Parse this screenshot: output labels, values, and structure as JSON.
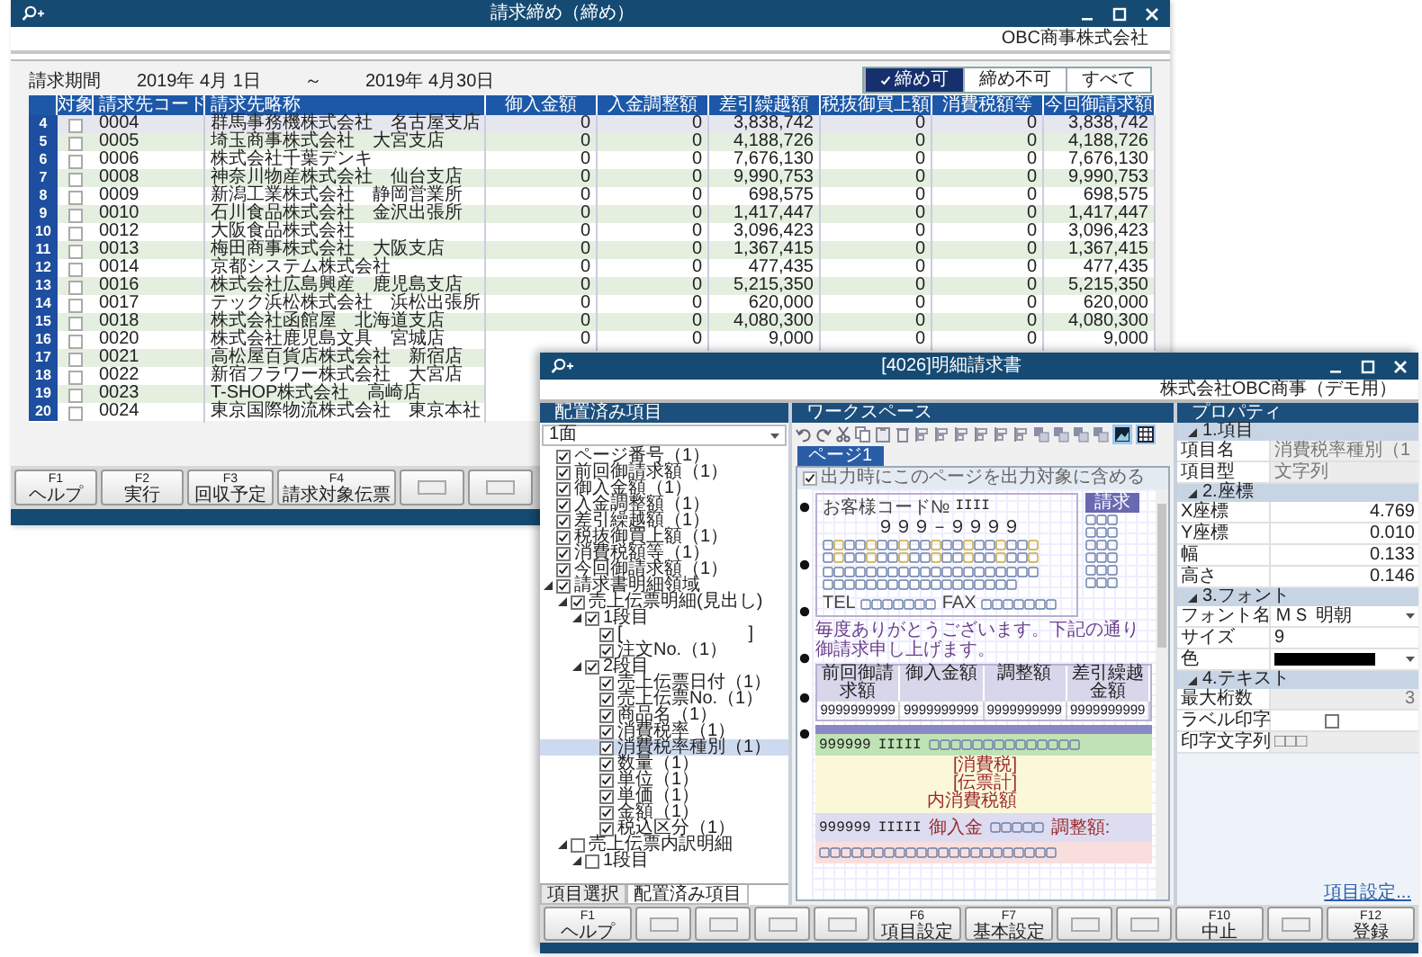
{
  "main_window": {
    "title": "請求締め（締め）",
    "company": "OBC商事株式会社",
    "period_label": "請求期間",
    "period_from": "2019年 4月 1日",
    "period_sep": "～",
    "period_to": "2019年 4月30日",
    "filters": [
      {
        "label": "締め可",
        "selected": true
      },
      {
        "label": "締め不可",
        "selected": false
      },
      {
        "label": "すべて",
        "selected": false
      }
    ],
    "table": {
      "check_column": "対象",
      "columns": [
        "請求先コード",
        "請求先略称",
        "御入金額",
        "入金調整額",
        "差引繰越額",
        "税抜御買上額",
        "消費税額等",
        "今回御請求額"
      ],
      "rows": [
        {
          "no": "4",
          "checked": false,
          "selected": true,
          "cells": [
            "0004",
            "群馬事務機株式会社　名古屋支店",
            "0",
            "0",
            "3,838,742",
            "0",
            "0",
            "3,838,742"
          ]
        },
        {
          "no": "5",
          "checked": false,
          "selected": false,
          "cells": [
            "0005",
            "埼玉商事株式会社　大宮支店",
            "0",
            "0",
            "4,188,726",
            "0",
            "0",
            "4,188,726"
          ]
        },
        {
          "no": "6",
          "checked": false,
          "selected": false,
          "cells": [
            "0006",
            "株式会社千葉デンキ",
            "0",
            "0",
            "7,676,130",
            "0",
            "0",
            "7,676,130"
          ]
        },
        {
          "no": "7",
          "checked": false,
          "selected": false,
          "cells": [
            "0008",
            "神奈川物産株式会社　仙台支店",
            "0",
            "0",
            "9,990,753",
            "0",
            "0",
            "9,990,753"
          ]
        },
        {
          "no": "8",
          "checked": false,
          "selected": false,
          "cells": [
            "0009",
            "新潟工業株式会社　静岡営業所",
            "0",
            "0",
            "698,575",
            "0",
            "0",
            "698,575"
          ]
        },
        {
          "no": "9",
          "checked": false,
          "selected": false,
          "cells": [
            "0010",
            "石川食品株式会社　金沢出張所",
            "0",
            "0",
            "1,417,447",
            "0",
            "0",
            "1,417,447"
          ]
        },
        {
          "no": "10",
          "checked": false,
          "selected": false,
          "cells": [
            "0012",
            "大阪食品株式会社",
            "0",
            "0",
            "3,096,423",
            "0",
            "0",
            "3,096,423"
          ]
        },
        {
          "no": "11",
          "checked": false,
          "selected": false,
          "cells": [
            "0013",
            "梅田商事株式会社　大阪支店",
            "0",
            "0",
            "1,367,415",
            "0",
            "0",
            "1,367,415"
          ]
        },
        {
          "no": "12",
          "checked": false,
          "selected": false,
          "cells": [
            "0014",
            "京都システム株式会社",
            "0",
            "0",
            "477,435",
            "0",
            "0",
            "477,435"
          ]
        },
        {
          "no": "13",
          "checked": false,
          "selected": false,
          "cells": [
            "0016",
            "株式会社広島興産　鹿児島支店",
            "0",
            "0",
            "5,215,350",
            "0",
            "0",
            "5,215,350"
          ]
        },
        {
          "no": "14",
          "checked": false,
          "selected": false,
          "cells": [
            "0017",
            "テック浜松株式会社　浜松出張所",
            "0",
            "0",
            "620,000",
            "0",
            "0",
            "620,000"
          ]
        },
        {
          "no": "15",
          "checked": false,
          "selected": false,
          "cells": [
            "0018",
            "株式会社函館屋　北海道支店",
            "0",
            "0",
            "4,080,300",
            "0",
            "0",
            "4,080,300"
          ]
        },
        {
          "no": "16",
          "checked": false,
          "selected": false,
          "cells": [
            "0020",
            "株式会社鹿児島文具　宮城店",
            "0",
            "0",
            "9,000",
            "0",
            "0",
            "9,000"
          ]
        },
        {
          "no": "17",
          "checked": false,
          "selected": false,
          "cells": [
            "0021",
            "高松屋百貨店株式会社　新宿店"
          ]
        },
        {
          "no": "18",
          "checked": false,
          "selected": false,
          "cells": [
            "0022",
            "新宿フラワー株式会社　大宮店"
          ]
        },
        {
          "no": "19",
          "checked": false,
          "selected": false,
          "cells": [
            "0023",
            "T-SHOP株式会社　高崎店"
          ]
        },
        {
          "no": "20",
          "checked": false,
          "selected": false,
          "cells": [
            "0024",
            "東京国際物流株式会社　東京本社"
          ]
        }
      ]
    },
    "function_keys": [
      {
        "kind": "key",
        "key": "F1",
        "label": "ヘルプ"
      },
      {
        "kind": "key",
        "key": "F2",
        "label": "実行"
      },
      {
        "kind": "key",
        "key": "F3",
        "label": "回収予定"
      },
      {
        "kind": "key",
        "key": "F4",
        "label": "請求対象伝票"
      },
      {
        "kind": "blank"
      },
      {
        "kind": "blank"
      }
    ]
  },
  "detail_window": {
    "title": "[4026]明細請求書",
    "company": "株式会社OBC商事（デモ用）",
    "left_pane": {
      "title": "配置済み項目",
      "dropdown": "1面",
      "tree": [
        {
          "label": "ページ番号（1）",
          "checked": true,
          "selected": false
        },
        {
          "label": "前回御請求額（1）",
          "checked": true,
          "selected": false
        },
        {
          "label": "御入金額（1）",
          "checked": true,
          "selected": false
        },
        {
          "label": "入金調整額（1）",
          "checked": true,
          "selected": false
        },
        {
          "label": "差引繰越額（1）",
          "checked": true,
          "selected": false
        },
        {
          "label": "税抜御買上額（1）",
          "checked": true,
          "selected": false
        },
        {
          "label": "消費税額等（1）",
          "checked": true,
          "selected": false
        },
        {
          "label": "今回御請求額（1）",
          "checked": true,
          "selected": false
        },
        {
          "label": "請求書明細領域",
          "checked": true,
          "selected": false,
          "expanded": true,
          "children": [
            {
              "label": "売上伝票明細(見出し)",
              "checked": true,
              "selected": false,
              "expanded": true,
              "children": [
                {
                  "label": "1段目",
                  "checked": true,
                  "selected": false,
                  "expanded": true,
                  "children": [
                    {
                      "label": "[　　　　　　　]",
                      "checked": true,
                      "selected": false
                    },
                    {
                      "label": "注文No.（1）",
                      "checked": true,
                      "selected": false
                    }
                  ]
                },
                {
                  "label": "2段目",
                  "checked": true,
                  "selected": false,
                  "expanded": true,
                  "children": [
                    {
                      "label": "売上伝票日付（1）",
                      "checked": true,
                      "selected": false
                    },
                    {
                      "label": "売上伝票No.（1）",
                      "checked": true,
                      "selected": false
                    },
                    {
                      "label": "商品名（1）",
                      "checked": true,
                      "selected": false
                    },
                    {
                      "label": "消費税率（1）",
                      "checked": true,
                      "selected": false
                    },
                    {
                      "label": "消費税率種別（1）",
                      "checked": true,
                      "selected": true
                    },
                    {
                      "label": "数量（1）",
                      "checked": true,
                      "selected": false
                    },
                    {
                      "label": "単位（1）",
                      "checked": true,
                      "selected": false
                    },
                    {
                      "label": "単価（1）",
                      "checked": true,
                      "selected": false
                    },
                    {
                      "label": "金額（1）",
                      "checked": true,
                      "selected": false
                    },
                    {
                      "label": "税込区分（1）",
                      "checked": true,
                      "selected": false
                    }
                  ]
                }
              ]
            },
            {
              "label": "売上伝票内訳明細",
              "checked": false,
              "selected": false,
              "expanded": true,
              "children": [
                {
                  "label": "1段目",
                  "checked": false,
                  "selected": false,
                  "expanded": true
                }
              ]
            }
          ]
        }
      ],
      "tabs": [
        {
          "label": "項目選択",
          "selected": false
        },
        {
          "label": "配置済み項目",
          "selected": true
        }
      ]
    },
    "workspace": {
      "title": "ワークスペース",
      "toolbar_toggles": [
        {
          "selected": true
        },
        {
          "selected": true
        }
      ],
      "page_tabs": [
        {
          "label": "ページ1",
          "selected": true
        }
      ],
      "include_page": {
        "label": "出力時にこのページを出力対象に含める",
        "checked": true
      },
      "preview": {
        "code_label": "お客様コード№",
        "code_value": "IIII",
        "zip": "９９９－９９９９",
        "tel_label": "TEL",
        "fax_label": "FAX",
        "title_tag": "請求",
        "greeting": "毎度ありがとうございます。下記の通り御請求申し上げます。",
        "summary_columns": [
          "前回御請求額",
          "御入金額",
          "調整額",
          "差引繰越金額"
        ],
        "summary_values": [
          "9999999999",
          "9999999999",
          "9999999999",
          "9999999999"
        ],
        "bands": [
          {
            "kind": "sales",
            "texts": [
              "999999",
              "IIIII"
            ]
          },
          {
            "kind": "totals",
            "texts": [
              "[消費税]",
              "[伝票計]",
              "内消費税額"
            ]
          },
          {
            "kind": "payment",
            "texts": [
              "999999",
              "IIIII",
              "御入金",
              "調整額:"
            ]
          },
          {
            "kind": "note"
          }
        ]
      }
    },
    "properties": {
      "title": "プロパティ",
      "sections": [
        {
          "title": "1.項目",
          "rows": [
            {
              "label": "項目名",
              "kind": "text",
              "value": "消費税率種別（1",
              "disabled": true
            },
            {
              "label": "項目型",
              "kind": "text",
              "value": "文字列",
              "disabled": true
            }
          ]
        },
        {
          "title": "2.座標",
          "rows": [
            {
              "label": "X座標",
              "kind": "number",
              "value": "4.769",
              "disabled": false
            },
            {
              "label": "Y座標",
              "kind": "number",
              "value": "0.010",
              "disabled": false
            },
            {
              "label": "幅",
              "kind": "number",
              "value": "0.133",
              "disabled": false
            },
            {
              "label": "高さ",
              "kind": "number",
              "value": "0.146",
              "disabled": false
            }
          ]
        },
        {
          "title": "3.フォント",
          "rows": [
            {
              "label": "フォント名",
              "kind": "dropdown",
              "value": "ＭＳ 明朝",
              "disabled": false
            },
            {
              "label": "サイズ",
              "kind": "text",
              "value": "9",
              "disabled": false
            },
            {
              "label": "色",
              "kind": "color",
              "color": "#000000",
              "disabled": false
            }
          ]
        },
        {
          "title": "4.テキスト",
          "rows": [
            {
              "label": "最大桁数",
              "kind": "number",
              "value": "3",
              "disabled": true
            },
            {
              "label": "ラベル印字",
              "kind": "checkbox",
              "checked": false,
              "disabled": false
            },
            {
              "label": "印字文字列",
              "kind": "text",
              "value": "□□□",
              "disabled": true
            }
          ]
        }
      ],
      "link": "項目設定..."
    },
    "function_keys": [
      {
        "kind": "key",
        "key": "F1",
        "label": "ヘルプ"
      },
      {
        "kind": "blank"
      },
      {
        "kind": "blank"
      },
      {
        "kind": "blank"
      },
      {
        "kind": "blank"
      },
      {
        "kind": "key",
        "key": "F6",
        "label": "項目設定"
      },
      {
        "kind": "key",
        "key": "F7",
        "label": "基本設定"
      },
      {
        "kind": "blank"
      },
      {
        "kind": "blank"
      },
      {
        "kind": "key",
        "key": "F10",
        "label": "中止"
      },
      {
        "kind": "blank"
      },
      {
        "kind": "key",
        "key": "F12",
        "label": "登録"
      }
    ]
  }
}
